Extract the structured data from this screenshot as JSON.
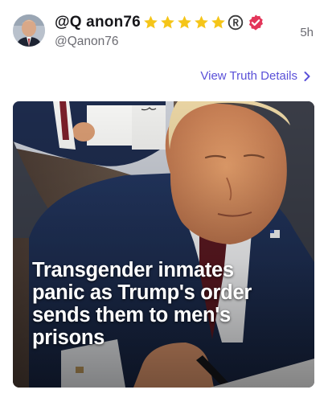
{
  "post": {
    "display_name": "@Q anon76",
    "star_count": 5,
    "handle": "@Qanon76",
    "timestamp": "5h"
  },
  "actions": {
    "view_details_label": "View Truth Details"
  },
  "media": {
    "headline": "Transgender inmates\npanic as Trump's order\nsends them to men's\nprisons"
  },
  "colors": {
    "accent": "#5a50d8",
    "star": "#f5c518",
    "verified": "#e3365a"
  }
}
